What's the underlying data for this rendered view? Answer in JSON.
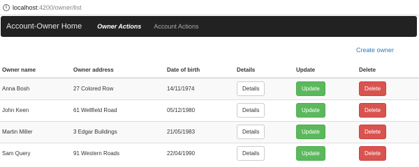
{
  "browser": {
    "url_host": "localhost",
    "url_path": ":4200/owner/list",
    "info_icon": "info-icon"
  },
  "navbar": {
    "brand": "Account-Owner Home",
    "links": [
      {
        "label": "Owner Actions",
        "active": true
      },
      {
        "label": "Account Actions",
        "active": false
      }
    ]
  },
  "create_link": "Create owner",
  "table": {
    "headers": [
      "Owner name",
      "Owner address",
      "Date of birth",
      "Details",
      "Update",
      "Delete"
    ],
    "rows": [
      {
        "name": "Anna Bosh",
        "address": "27 Colored Row",
        "dob": "14/11/1974"
      },
      {
        "name": "John Keen",
        "address": "61 Wellfield Road",
        "dob": "05/12/1980"
      },
      {
        "name": "Martin Miller",
        "address": "3 Edgar Buildings",
        "dob": "21/05/1983"
      },
      {
        "name": "Sam Query",
        "address": "91 Western Roads",
        "dob": "22/04/1990"
      }
    ],
    "buttons": {
      "details": "Details",
      "update": "Update",
      "delete": "Delete"
    }
  },
  "colors": {
    "navbar_bg": "#222222",
    "link": "#337ab7",
    "update": "#5cb85c",
    "delete": "#d9534f"
  }
}
